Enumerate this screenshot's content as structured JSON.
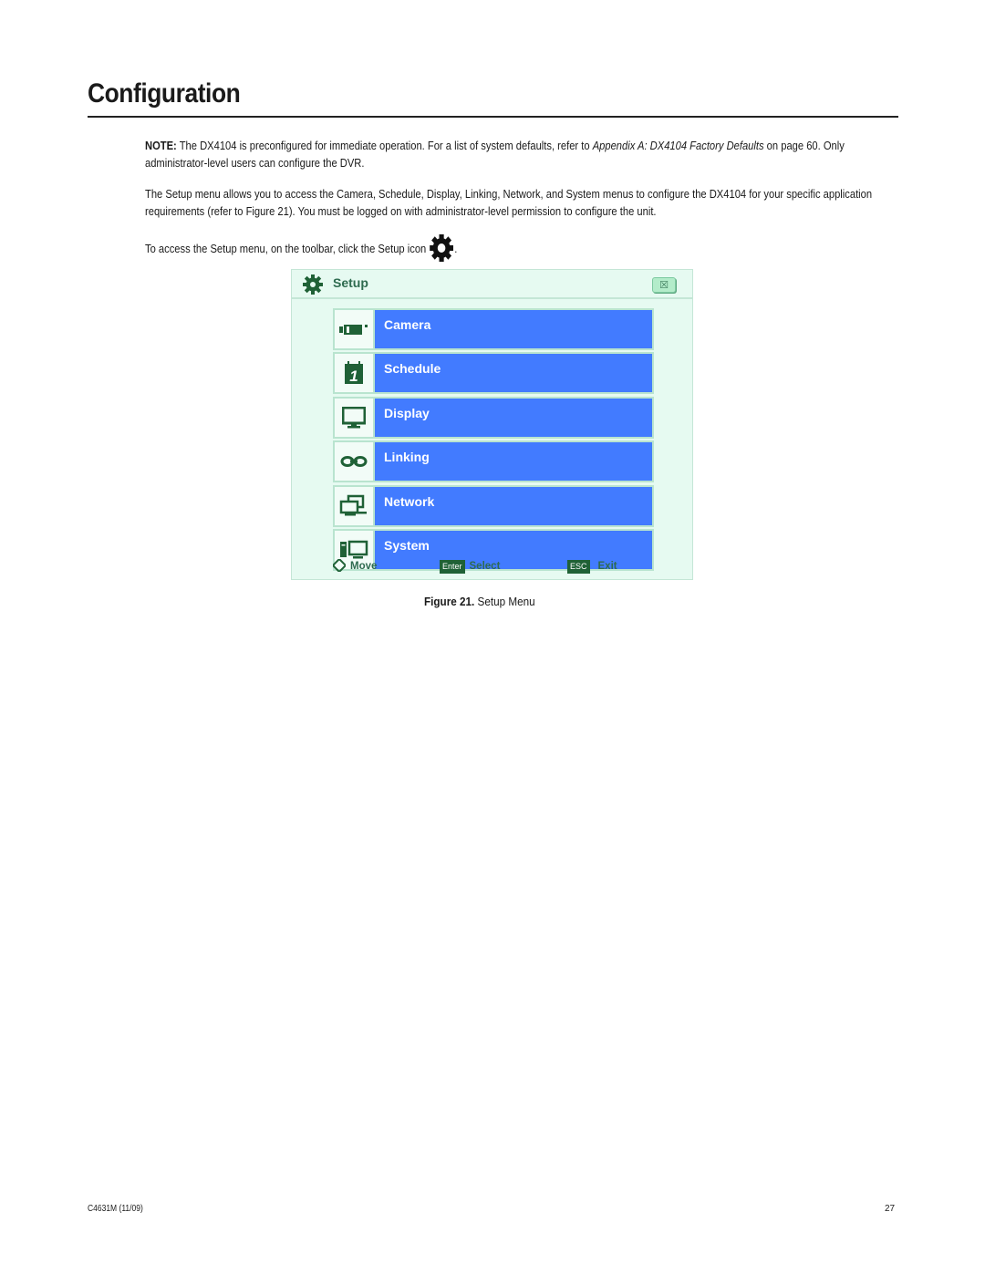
{
  "page": {
    "title": "Configuration",
    "note_label": "NOTE:",
    "note_text_1": " The DX4104 is preconfigured for immediate operation. For a list of system defaults, refer to ",
    "note_link": "Appendix A: DX4104 Factory Defaults",
    "note_text_2": " on page 60. Only administrator-level users can configure the DVR.",
    "para2": "The Setup menu allows you to access the Camera, Schedule, Display, Linking, Network, and System menus to configure the DX4104 for your specific application requirements (refer to Figure 21). You must be logged on with administrator-level permission to configure the unit.",
    "para3": "To access the Setup menu, on the toolbar, click the Setup icon",
    "para3_end": ".",
    "inline_icon": "gear-icon"
  },
  "setup_menu": {
    "title": "Setup",
    "title_icon": "gear-icon",
    "close_label": "☒",
    "items": [
      {
        "label": "Camera",
        "icon": "camera-icon"
      },
      {
        "label": "Schedule",
        "icon": "calendar-icon"
      },
      {
        "label": "Display",
        "icon": "monitor-icon"
      },
      {
        "label": "Linking",
        "icon": "link-icon"
      },
      {
        "label": "Network",
        "icon": "network-icon"
      },
      {
        "label": "System",
        "icon": "computer-icon"
      }
    ],
    "footer": {
      "move_label": "Move",
      "enter_key": "Enter",
      "select_label": "Select",
      "esc_key": "ESC",
      "exit_label": "Exit"
    },
    "colors": {
      "window_bg": "#e6faf1",
      "item_bg": "#427bff",
      "icon_green": "#1f6136"
    }
  },
  "figure": {
    "number": "Figure 21.",
    "caption": "Setup Menu"
  },
  "footer": {
    "doc_id": "C4631M (11/09)",
    "page_number": "27"
  }
}
